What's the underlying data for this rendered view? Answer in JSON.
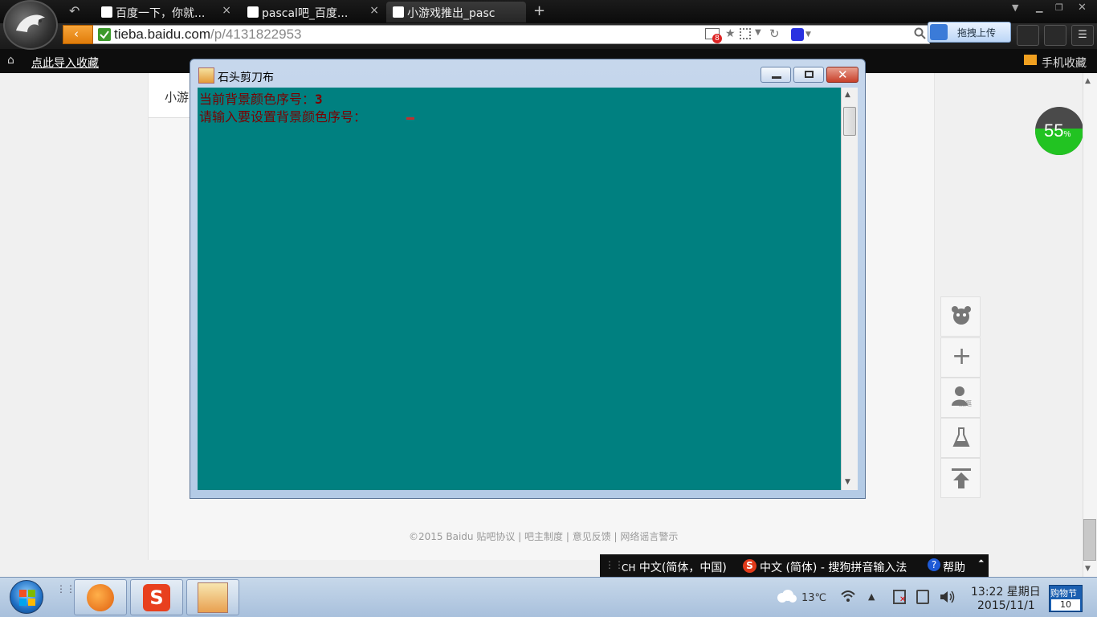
{
  "browser": {
    "tabs": [
      {
        "label": "百度一下，你就...",
        "active": false
      },
      {
        "label": "pascal吧_百度...",
        "active": false
      },
      {
        "label": "小游戏推出_pasc",
        "active": true
      }
    ],
    "new_tab_symbol": "+",
    "url": {
      "host": "tieba.baidu.com",
      "path": "/p/4131822953"
    },
    "upload_label": "拖拽上传",
    "bookmark_import": "点此导入收藏",
    "mobile_bookmarks": "手机收藏",
    "badge_count": "8"
  },
  "page": {
    "header_fragment": "小游",
    "footer": {
      "copyright": "©2015 Baidu",
      "links": [
        "贴吧协议",
        "吧主制度",
        "意见反馈",
        "网络谣言警示"
      ]
    },
    "progress_text": "55",
    "progress_percent": 55,
    "progress_unit": "%",
    "side_label_1": "爱逛"
  },
  "console_window": {
    "title": "石头剪刀布",
    "line1_label": "当前背景颜色序号：",
    "line1_value": "3",
    "line2_label": "请输入要设置背景颜色序号：",
    "bg_color": "#008080",
    "text_color": "#7a0000"
  },
  "ime": {
    "lang": "CH",
    "layout": "中文(简体，中国)",
    "method": "中文 (简体) - 搜狗拼音输入法",
    "help": "帮助"
  },
  "taskbar": {
    "weather": "13℃",
    "time": "13:22 星期日",
    "date": "2015/11/1",
    "shopping_label": "购物节",
    "shopping_count": "10"
  }
}
